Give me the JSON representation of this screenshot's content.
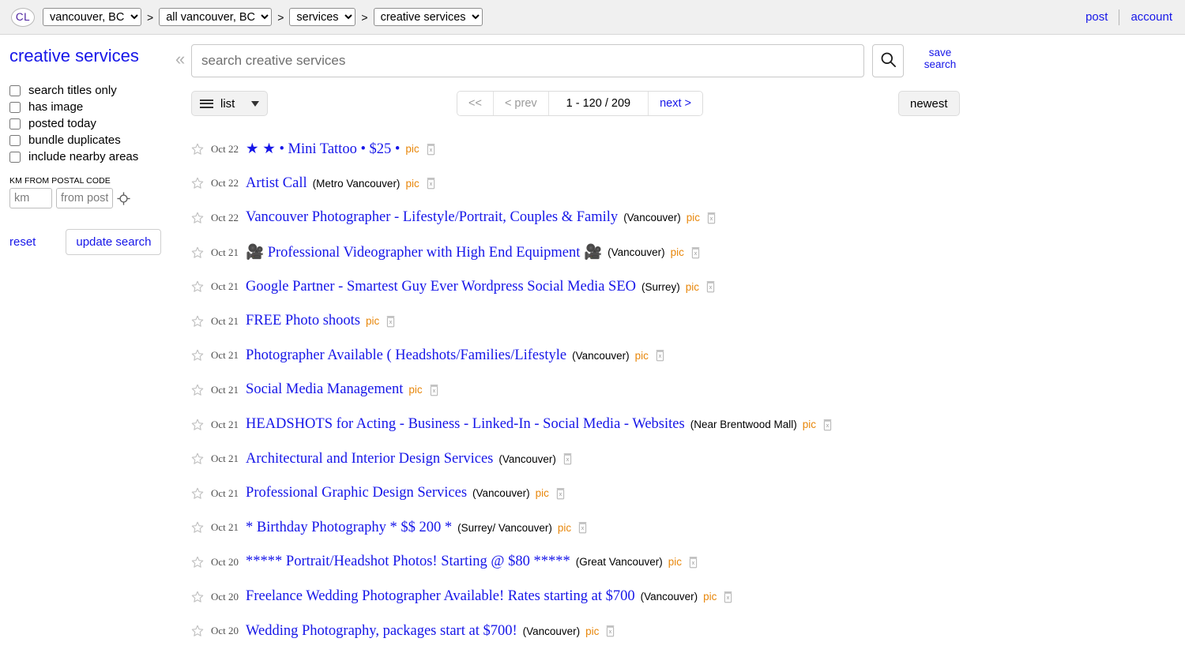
{
  "header": {
    "logo_text": "CL",
    "breadcrumb_separator": ">",
    "selects": [
      {
        "name": "region",
        "value": "vancouver, BC",
        "options": [
          "vancouver, BC"
        ]
      },
      {
        "name": "subarea",
        "value": "all vancouver, BC",
        "options": [
          "all vancouver, BC"
        ]
      },
      {
        "name": "category-group",
        "value": "services",
        "options": [
          "services"
        ]
      },
      {
        "name": "category",
        "value": "creative services",
        "options": [
          "creative services"
        ]
      }
    ],
    "post_label": "post",
    "account_label": "account"
  },
  "sidebar": {
    "category_title": "creative services",
    "checkboxes": [
      {
        "label": "search titles only",
        "checked": false
      },
      {
        "label": "has image",
        "checked": false
      },
      {
        "label": "posted today",
        "checked": false
      },
      {
        "label": "bundle duplicates",
        "checked": false
      },
      {
        "label": "include nearby areas",
        "checked": false
      }
    ],
    "distance_label": "KM FROM POSTAL CODE",
    "distance_placeholder": "km",
    "distance_value": "",
    "postal_placeholder": "from postal code",
    "postal_value": "",
    "locate_icon": "crosshair-icon",
    "reset_label": "reset",
    "update_label": "update search"
  },
  "search": {
    "placeholder": "search creative services",
    "value": "",
    "search_icon": "magnifier-icon",
    "save_search_label": "save search",
    "collapse_icon": "«"
  },
  "toolbar": {
    "view_label": "list",
    "view_icon": "hamburger-icon",
    "first_label": "<<",
    "prev_label": "< prev",
    "count_label": "1 - 120 / 209",
    "next_label": "next >",
    "sort_label": "newest"
  },
  "listings": [
    {
      "date": "Oct 22",
      "prefix": "★ ★ • ",
      "title": "Mini Tattoo • $25 •",
      "suffix": "",
      "hood": "",
      "pic": "pic"
    },
    {
      "date": "Oct 22",
      "prefix": "",
      "title": "Artist Call",
      "suffix": "",
      "hood": "(Metro Vancouver)",
      "pic": "pic"
    },
    {
      "date": "Oct 22",
      "prefix": "",
      "title": "Vancouver Photographer - Lifestyle/Portrait, Couples & Family",
      "suffix": "",
      "hood": "(Vancouver)",
      "pic": "pic"
    },
    {
      "date": "Oct 21",
      "prefix": "🎥 ",
      "title": "Professional Videographer with High End Equipment",
      "suffix": " 🎥",
      "hood": "(Vancouver)",
      "pic": "pic"
    },
    {
      "date": "Oct 21",
      "prefix": "",
      "title": "Google Partner - Smartest Guy Ever Wordpress Social Media SEO",
      "suffix": "",
      "hood": "(Surrey)",
      "pic": "pic"
    },
    {
      "date": "Oct 21",
      "prefix": "",
      "title": "FREE Photo shoots",
      "suffix": "",
      "hood": "",
      "pic": "pic"
    },
    {
      "date": "Oct 21",
      "prefix": "",
      "title": "Photographer Available ( Headshots/Families/Lifestyle",
      "suffix": "",
      "hood": "(Vancouver)",
      "pic": "pic"
    },
    {
      "date": "Oct 21",
      "prefix": "",
      "title": "Social Media Management",
      "suffix": "",
      "hood": "",
      "pic": "pic"
    },
    {
      "date": "Oct 21",
      "prefix": "",
      "title": "HEADSHOTS for Acting - Business - Linked-In - Social Media - Websites",
      "suffix": "",
      "hood": "(Near Brentwood Mall)",
      "pic": "pic"
    },
    {
      "date": "Oct 21",
      "prefix": "",
      "title": "Architectural and Interior Design Services",
      "suffix": "",
      "hood": "(Vancouver)",
      "pic": ""
    },
    {
      "date": "Oct 21",
      "prefix": "",
      "title": "Professional Graphic Design Services",
      "suffix": "",
      "hood": "(Vancouver)",
      "pic": "pic"
    },
    {
      "date": "Oct 21",
      "prefix": "",
      "title": "* Birthday Photography * $$ 200 *",
      "suffix": "",
      "hood": "(Surrey/ Vancouver)",
      "pic": "pic"
    },
    {
      "date": "Oct 20",
      "prefix": "",
      "title": "***** Portrait/Headshot Photos! Starting @ $80 *****",
      "suffix": "",
      "hood": "(Great Vancouver)",
      "pic": "pic"
    },
    {
      "date": "Oct 20",
      "prefix": "",
      "title": "Freelance Wedding Photographer Available! Rates starting at $700",
      "suffix": "",
      "hood": "(Vancouver)",
      "pic": "pic"
    },
    {
      "date": "Oct 20",
      "prefix": "",
      "title": "Wedding Photography, packages start at $700!",
      "suffix": "",
      "hood": "(Vancouver)",
      "pic": "pic"
    }
  ],
  "colors": {
    "link_blue": "#1616e8",
    "pic_orange": "#e8870b",
    "logo_purple": "#4a1e9e",
    "header_bg": "#f0f0f0"
  }
}
